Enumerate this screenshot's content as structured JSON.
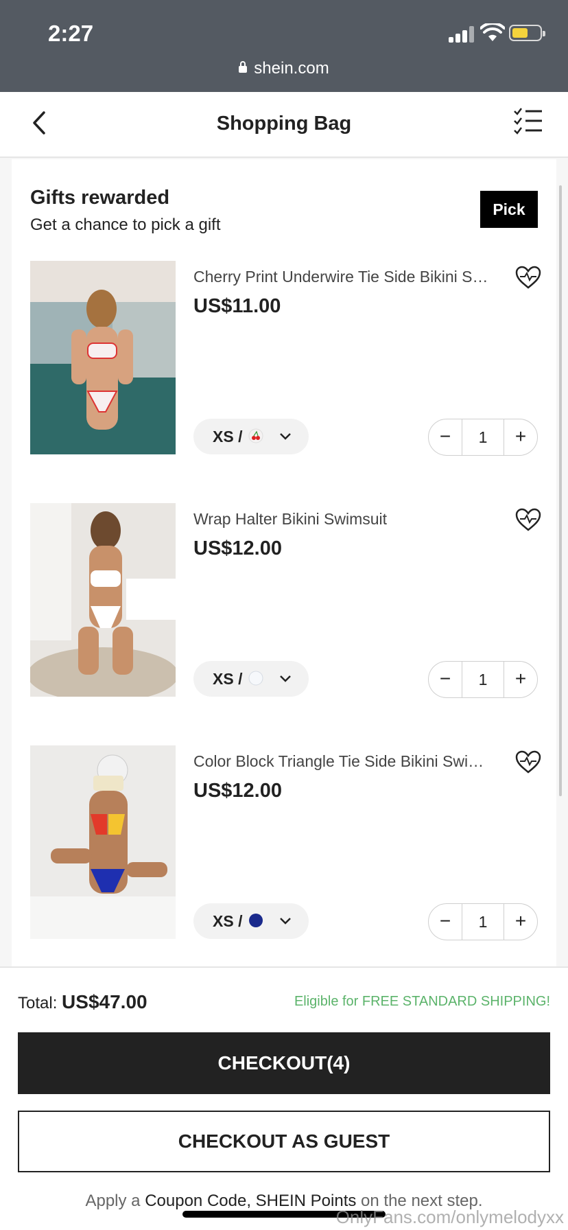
{
  "status_bar": {
    "time": "2:27",
    "url": "shein.com"
  },
  "header": {
    "title": "Shopping Bag"
  },
  "gifts": {
    "title": "Gifts rewarded",
    "subtitle": "Get a chance to pick a gift",
    "pick_label": "Pick"
  },
  "items": [
    {
      "name": "Cherry Print Underwire Tie Side Bikini Swimsuit",
      "price": "US$11.00",
      "size": "XS /",
      "swatch": "cherry-print",
      "quantity": "1"
    },
    {
      "name": "Wrap Halter Bikini Swimsuit",
      "price": "US$12.00",
      "size": "XS /",
      "swatch": "white",
      "quantity": "1"
    },
    {
      "name": "Color Block Triangle Tie Side Bikini Swimsuit",
      "price": "US$12.00",
      "size": "XS /",
      "swatch": "navy",
      "quantity": "1"
    }
  ],
  "qty_controls": {
    "minus": "−",
    "plus": "+"
  },
  "footer": {
    "total_label": "Total:",
    "total_value": "US$47.00",
    "shipping_note": "Eligible for FREE STANDARD SHIPPING!",
    "checkout_label": "CHECKOUT(4)",
    "guest_label": "CHECKOUT AS GUEST",
    "apply_prefix": "Apply a",
    "apply_highlight": "Coupon Code, SHEIN Points",
    "apply_suffix": "on the next step."
  },
  "watermark": "OnlyFans.com/onlymelodyxx",
  "colors": {
    "status_bg": "#545a62",
    "shipping_green": "#5bb36a",
    "battery": "#f4d33c",
    "navy_swatch": "#1a2a8c"
  }
}
